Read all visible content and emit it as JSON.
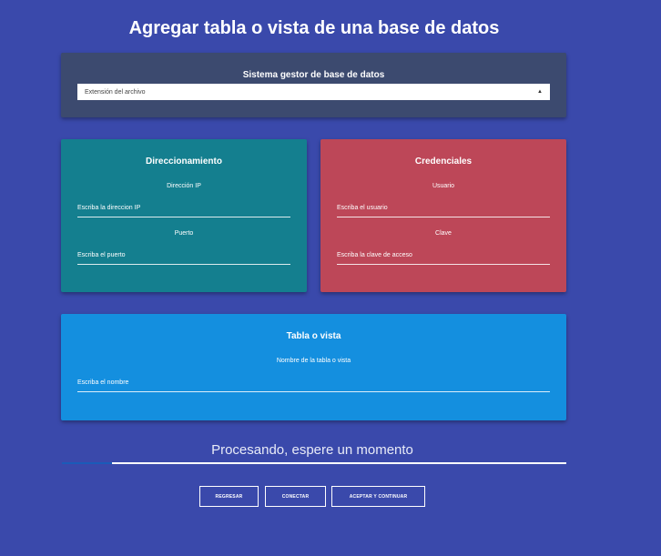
{
  "page": {
    "title": "Agregar tabla o vista de una base de datos"
  },
  "dbms": {
    "title": "Sistema gestor de base de datos",
    "selected": "Extensión del archivo"
  },
  "addressing": {
    "title": "Direccionamiento",
    "ip_label": "Dirección IP",
    "ip_placeholder": "Escriba la direccion IP",
    "port_label": "Puerto",
    "port_placeholder": "Escriba el puerto"
  },
  "credentials": {
    "title": "Credenciales",
    "user_label": "Usuario",
    "user_placeholder": "Escriba el usuario",
    "password_label": "Clave",
    "password_placeholder": "Escriba la clave de acceso"
  },
  "table": {
    "title": "Tabla o vista",
    "name_label": "Nombre de la tabla o vista",
    "name_placeholder": "Escriba el nombre"
  },
  "progress": {
    "text": "Procesando, espere un momento",
    "fraction": 0.1,
    "color": "#1b5bb8"
  },
  "buttons": {
    "back": "REGRESAR",
    "connect": "CONECTAR",
    "accept": "ACEPTAR Y CONTINUAR"
  },
  "colors": {
    "background": "#3a49ab",
    "dbms_card": "#3c4a6f",
    "addr_card": "#147f8f",
    "cred_card": "#bd4758",
    "table_card": "#148fdf"
  }
}
